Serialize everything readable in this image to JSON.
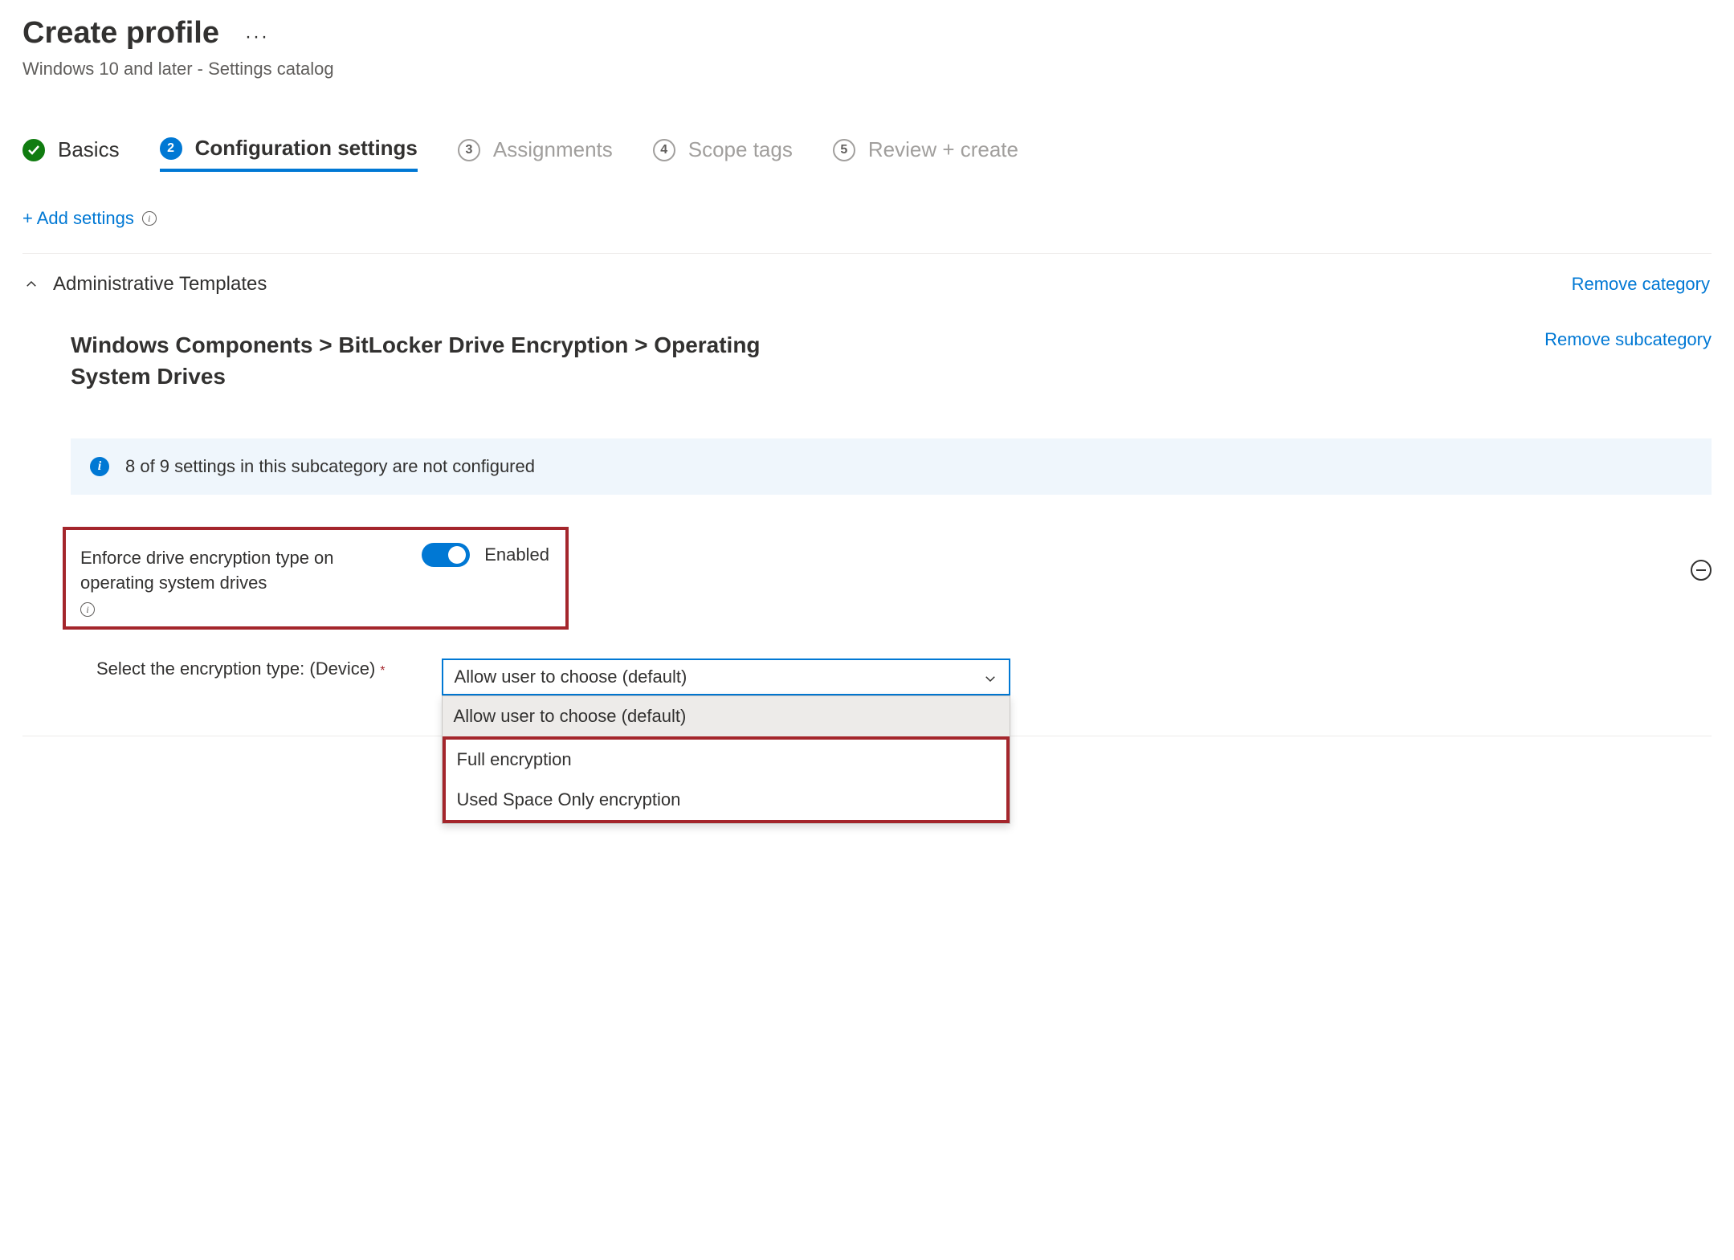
{
  "header": {
    "title": "Create profile",
    "subtitle": "Windows 10 and later - Settings catalog"
  },
  "steps": {
    "basics": "Basics",
    "config": "Configuration settings",
    "assign": "Assignments",
    "scope": "Scope tags",
    "review": "Review + create",
    "n2": "2",
    "n3": "3",
    "n4": "4",
    "n5": "5"
  },
  "actions": {
    "add_settings": "+ Add settings"
  },
  "section": {
    "title": "Administrative Templates",
    "remove_category": "Remove category",
    "breadcrumb": "Windows Components > BitLocker Drive Encryption > Operating System Drives",
    "remove_subcategory": "Remove subcategory"
  },
  "banner": {
    "text": "8 of 9 settings in this subcategory are not configured"
  },
  "setting": {
    "label": "Enforce drive encryption type on operating system drives",
    "toggle_state": "Enabled"
  },
  "dropdown": {
    "label": "Select the encryption type: (Device)",
    "selected": "Allow user to choose (default)",
    "options": {
      "a": "Allow user to choose (default)",
      "b": "Full encryption",
      "c": "Used Space Only encryption"
    }
  }
}
